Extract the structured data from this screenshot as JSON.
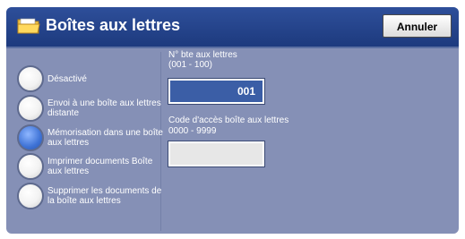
{
  "window": {
    "title": "Boîtes aux lettres",
    "icon": "folder-icon"
  },
  "toolbar": {
    "cancel_label": "Annuler"
  },
  "options": [
    {
      "label": "Désactivé",
      "selected": false
    },
    {
      "label": "Envoi à une boîte aux lettres distante",
      "selected": false
    },
    {
      "label": "Mémorisation dans une boîte aux lettres",
      "selected": true
    },
    {
      "label": "Imprimer documents Boîte aux lettres",
      "selected": false
    },
    {
      "label": "Supprimer les documents de la boîte aux lettres",
      "selected": false
    }
  ],
  "mailbox_number": {
    "label": "N° bte aux lettres",
    "range": "(001 - 100)",
    "value": "001"
  },
  "access_code": {
    "label": "Code d'accès boîte aux lettres",
    "range": "0000 - 9999",
    "value": ""
  },
  "colors": {
    "panel": "#8590b6",
    "title_bar": "#1d3a7e",
    "field_active": "#3b5ea6"
  }
}
